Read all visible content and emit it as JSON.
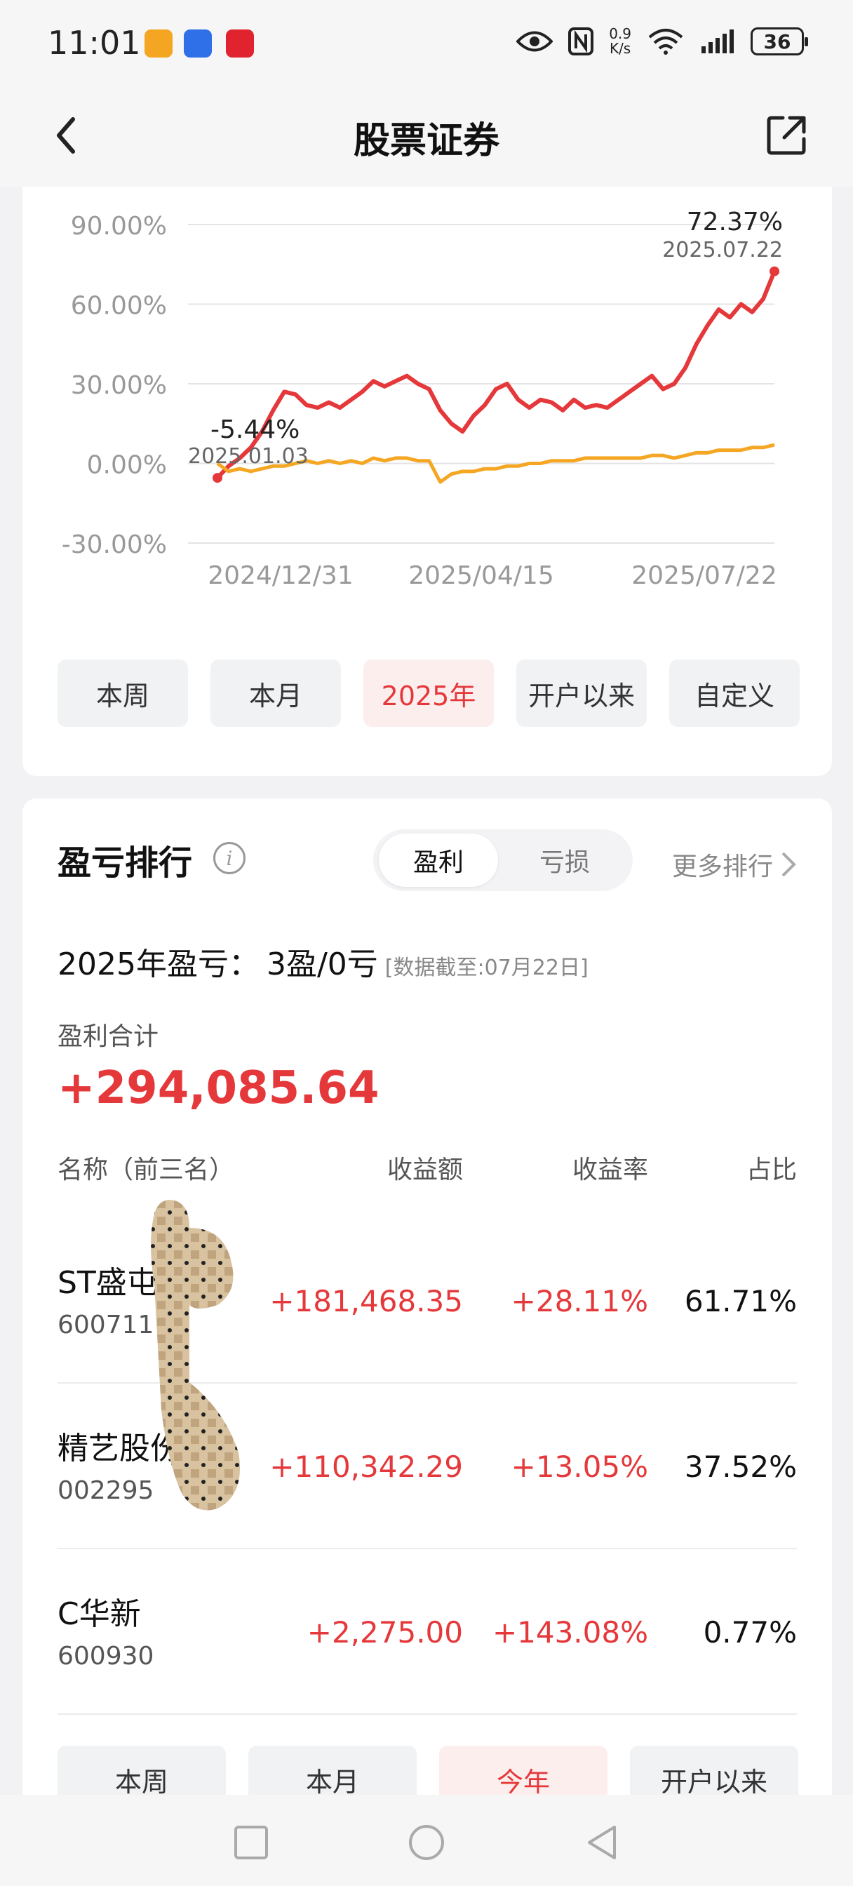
{
  "status_bar": {
    "time": "11:01",
    "net_speed_value": "0.9",
    "net_speed_unit": "K/s",
    "battery": "36",
    "icons": [
      "eye-icon",
      "nfc-icon",
      "wifi-icon",
      "signal-icon",
      "battery-icon"
    ]
  },
  "header": {
    "title": "股票证券",
    "back_icon": "chevron-left-icon",
    "share_icon": "share-icon"
  },
  "chart_data": {
    "type": "line",
    "y_ticks": [
      "90.00%",
      "60.00%",
      "30.00%",
      "0.00%",
      "-30.00%"
    ],
    "x_ticks": [
      "2024/12/31",
      "2025/04/15",
      "2025/07/22"
    ],
    "ylim": [
      -30,
      90
    ],
    "series": [
      {
        "color": "#e5383b",
        "values": [
          -5.44,
          -1,
          2,
          6,
          12,
          20,
          27,
          26,
          22,
          21,
          23,
          21,
          24,
          27,
          31,
          29,
          31,
          33,
          30,
          28,
          20,
          15,
          12,
          18,
          22,
          28,
          30,
          24,
          21,
          24,
          23,
          20,
          24,
          21,
          22,
          21,
          24,
          27,
          30,
          33,
          28,
          30,
          36,
          45,
          52,
          58,
          55,
          60,
          57,
          62,
          72.37
        ]
      },
      {
        "color": "#f5a623",
        "values": [
          0,
          -3,
          -2,
          -3,
          -2,
          -1,
          -1,
          0,
          1,
          0,
          1,
          0,
          1,
          0,
          2,
          1,
          2,
          2,
          1,
          1,
          -7,
          -4,
          -3,
          -3,
          -2,
          -2,
          -1,
          -1,
          0,
          0,
          1,
          1,
          1,
          2,
          2,
          2,
          2,
          2,
          2,
          3,
          3,
          2,
          3,
          4,
          4,
          5,
          5,
          5,
          6,
          6,
          7
        ]
      }
    ],
    "annotations": [
      {
        "value": "72.37%",
        "date": "2025.07.22"
      },
      {
        "value": "-5.44%",
        "date": "2025.01.03"
      }
    ]
  },
  "period_tabs": [
    {
      "label": "本周",
      "active": false
    },
    {
      "label": "本月",
      "active": false
    },
    {
      "label": "2025年",
      "active": true
    },
    {
      "label": "开户以来",
      "active": false
    },
    {
      "label": "自定义",
      "active": false
    }
  ],
  "ranking": {
    "title": "盈亏排行",
    "info_icon": "info-icon",
    "segment_profit": "盈利",
    "segment_loss": "亏损",
    "more": "更多排行",
    "summary_label": "2025年盈亏：",
    "summary_value": "3盈/0亏",
    "summary_note": "[数据截至:07月22日]",
    "profit_total_label": "盈利合计",
    "profit_total": "+294,085.64",
    "columns": [
      "名称（前三名）",
      "收益额",
      "收益率",
      "占比"
    ],
    "rows": [
      {
        "name": "ST盛屯",
        "code": "600711",
        "amount": "+181,468.35",
        "rate": "+28.11%",
        "ratio": "61.71%"
      },
      {
        "name": "精艺股份",
        "code": "002295",
        "amount": "+110,342.29",
        "rate": "+13.05%",
        "ratio": "37.52%"
      },
      {
        "name": "C华新",
        "code": "600930",
        "amount": "+2,275.00",
        "rate": "+143.08%",
        "ratio": "0.77%"
      }
    ],
    "bottom_tabs": [
      {
        "label": "本周",
        "active": false
      },
      {
        "label": "本月",
        "active": false
      },
      {
        "label": "今年",
        "active": true
      },
      {
        "label": "开户以来",
        "active": false
      }
    ]
  },
  "nav_bar": {
    "icons": [
      "recents-square-icon",
      "home-circle-icon",
      "back-triangle-icon"
    ]
  }
}
